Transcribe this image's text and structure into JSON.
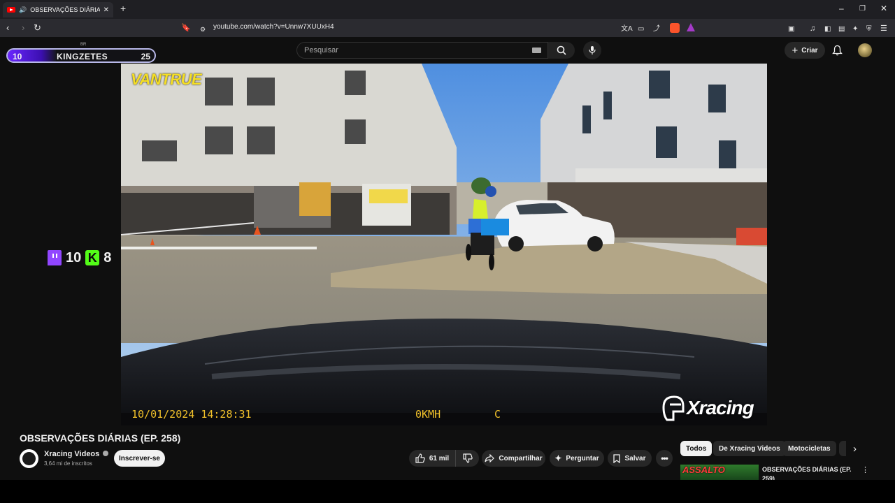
{
  "browser": {
    "tab_title": "OBSERVAÇÕES DIÁRIAS (EP. 258)",
    "url": "youtube.com/watch?v=Unnw7XUUxH4",
    "window_controls": [
      "minimize-icon",
      "restore-icon",
      "close-icon"
    ]
  },
  "youtube": {
    "logo_region": "BR",
    "search_placeholder": "Pesquisar",
    "create_label": "Criar"
  },
  "overlay": {
    "left_score": "10",
    "name": "KINGZETES",
    "right_score": "25",
    "fill_fraction": 0.33,
    "twitch_count": "10",
    "kick_count": "8",
    "colors": {
      "twitch": "#9146ff",
      "kick": "#53fc18",
      "fill": "#6a27ff"
    }
  },
  "video": {
    "brand": "VANTRUE",
    "timestamp": "10/01/2024 14:28:31",
    "speed": "0KMH",
    "flag": "C",
    "watermark": "Xracing",
    "osd_color": "#f0c02a"
  },
  "details": {
    "title": "OBSERVAÇÕES DIÁRIAS (EP. 258)",
    "channel": "Xracing Videos",
    "subscribers": "3,64 mi de inscritos",
    "subscribe_label": "Inscrever-se",
    "likes": "61 mil",
    "share_label": "Compartilhar",
    "ask_label": "Perguntar",
    "save_label": "Salvar"
  },
  "sidebar": {
    "chips": [
      "Todos",
      "De Xracing Videos",
      "Motocicletas"
    ],
    "recommendation": {
      "thumb_text": "ASSALTO",
      "title": "OBSERVAÇÕES DIÁRIAS (EP. 259)"
    }
  }
}
